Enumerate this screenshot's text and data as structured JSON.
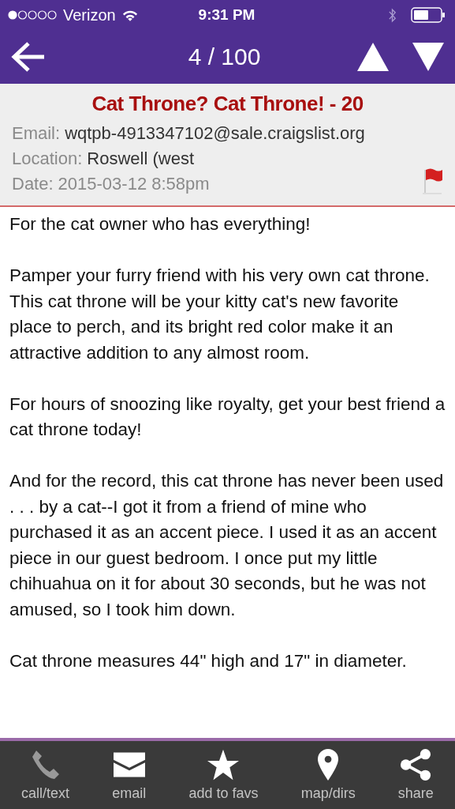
{
  "status_bar": {
    "carrier": "Verizon",
    "time": "9:31 PM"
  },
  "nav": {
    "counter": "4 / 100"
  },
  "listing": {
    "title": "Cat Throne? Cat Throne! - 20",
    "fields": [
      {
        "label": "Email:",
        "value": "wqtpb-4913347102@sale.craigslist.org"
      },
      {
        "label": "Location:",
        "value": "Roswell (west"
      },
      {
        "label": "Date:",
        "value": "2015-03-12 8:58pm"
      }
    ],
    "flagged": true,
    "body": [
      "For the cat owner who has everything!",
      "Pamper your furry friend with his very own cat throne. This cat throne will be your kitty cat's new favorite place to perch, and its bright red color make it an attractive addition to any almost room.",
      "For hours of snoozing like royalty, get your best friend a cat throne today!",
      "And for the record, this cat throne has never been used . . . by a cat--I got it from a friend of mine who purchased it as an accent piece. I used it as an accent piece in our guest bedroom. I once put my little chihuahua on it for about 30 seconds, but he was not amused, so I took him down.",
      "Cat throne measures 44\" high and 17\" in diameter."
    ]
  },
  "toolbar": [
    {
      "kind": "phone",
      "label": "call/text",
      "disabled": true
    },
    {
      "kind": "email",
      "label": "email",
      "disabled": false
    },
    {
      "kind": "star",
      "label": "add to favs",
      "disabled": false
    },
    {
      "kind": "pin",
      "label": "map/dirs",
      "disabled": false
    },
    {
      "kind": "share",
      "label": "share",
      "disabled": false
    }
  ]
}
